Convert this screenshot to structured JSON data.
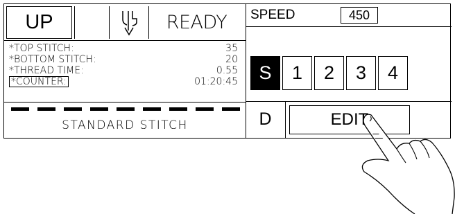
{
  "status_row": {
    "up_label": "UP",
    "needle_icon": "needle-presser-icon",
    "status_text": "READY"
  },
  "info": {
    "rows": [
      {
        "label": "*TOP STITCH:",
        "value": "35"
      },
      {
        "label": "*BOTTOM STITCH:",
        "value": "20"
      },
      {
        "label": "*THREAD TIME:",
        "value": "0.55"
      }
    ],
    "counter_label": "*COUNTER:",
    "counter_value": "01:20:45"
  },
  "pattern": {
    "name": "STANDARD STITCH"
  },
  "speed": {
    "label": "SPEED",
    "value": "450"
  },
  "modes": [
    {
      "label": "S",
      "active": true
    },
    {
      "label": "1",
      "active": false
    },
    {
      "label": "2",
      "active": false
    },
    {
      "label": "3",
      "active": false
    },
    {
      "label": "4",
      "active": false
    }
  ],
  "bottom": {
    "d_label": "D",
    "edit_label": "EDIT"
  },
  "overlay": {
    "hand_icon": "pointing-hand-icon"
  }
}
